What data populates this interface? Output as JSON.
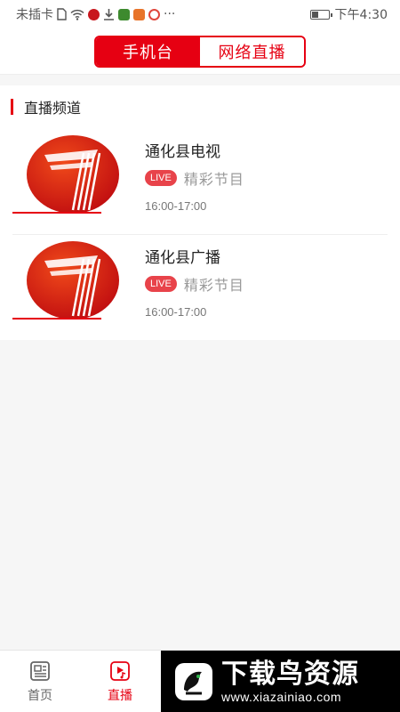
{
  "statusbar": {
    "carrier": "未插卡",
    "time": "下午4:30",
    "battery_level": 0.4,
    "more": "···"
  },
  "header": {
    "tabs": [
      {
        "label": "手机台",
        "active": true
      },
      {
        "label": "网络直播",
        "active": false
      }
    ]
  },
  "section": {
    "title": "直播频道"
  },
  "channels": [
    {
      "name": "通化县电视",
      "badge": "LIVE",
      "program": "精彩节目",
      "time": "16:00-17:00"
    },
    {
      "name": "通化县广播",
      "badge": "LIVE",
      "program": "精彩节目",
      "time": "16:00-17:00"
    }
  ],
  "tabbar": {
    "items": [
      {
        "label": "首页",
        "icon": "news-icon",
        "active": false
      },
      {
        "label": "直播",
        "icon": "live-play-icon",
        "active": true
      }
    ]
  },
  "watermark": {
    "title": "下载鸟资源",
    "url": "www.xiazainiao.com"
  },
  "colors": {
    "accent": "#e60012",
    "live_badge": "#e8434a"
  }
}
